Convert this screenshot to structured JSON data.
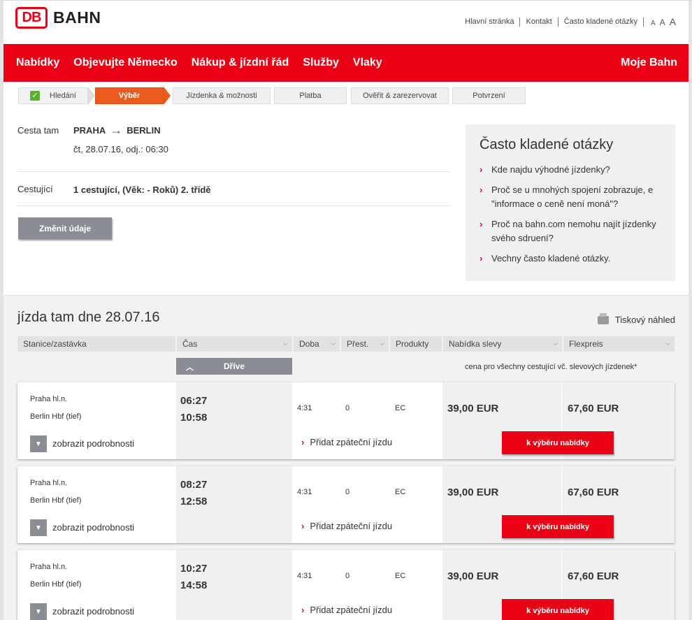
{
  "brand": {
    "logo": "DB",
    "name": "BAHN"
  },
  "topnav": [
    "Hlavní stránka",
    "Kontakt",
    "Často kladené otázky"
  ],
  "font_size_controls": [
    "A",
    "A",
    "A"
  ],
  "mainnav": [
    "Nabídky",
    "Objevujte Německo",
    "Nákup & jízdní řád",
    "Služby",
    "Vlaky"
  ],
  "mainnav_right": "Moje Bahn",
  "steps": [
    "Hledání",
    "Výběr",
    "Jízdenka & možnosti",
    "Platba",
    "Ověřit & zarezervovat",
    "Potvrzení"
  ],
  "summary": {
    "outbound_label": "Cesta tam",
    "from": "PRAHA",
    "to": "BERLIN",
    "datetime": "čt, 28.07.16, odj.: 06:30",
    "passengers_label": "Cestující",
    "passengers": "1 cestující, (Věk: - Roků) 2. třídě",
    "change_button": "Změnit údaje"
  },
  "faq": {
    "title": "Často kladené otázky",
    "items": [
      "Kde najdu výhodné jízdenky?",
      "Proč se u mnohých spojení zobrazuje, e \"informace o ceně není moná\"?",
      "Proč na bahn.com nemohu najít jízdenky svého sdruení?",
      "Vechny často kladené otázky."
    ]
  },
  "results": {
    "title": "jízda tam dne 28.07.16",
    "print_label": "Tiskový náhled",
    "columns": [
      "Stanice/zastávka",
      "Čas",
      "Doba",
      "Přest.",
      "Produkty",
      "Nabídka slevy",
      "Flexpreis"
    ],
    "earlier_button": "Dříve",
    "price_note": "cena pro všechny cestující vč. slevových jízdenek*",
    "detail_label": "zobrazit podrobnosti",
    "return_label": "Přidat zpáteční jízdu",
    "select_label": "k výběru nabídky",
    "connections": [
      {
        "from": "Praha hl.n.",
        "to": "Berlin Hbf (tief)",
        "dep": "06:27",
        "arr": "10:58",
        "duration": "4:31",
        "changes": "0",
        "product": "EC",
        "saver": "39,00 EUR",
        "flex": "67,60 EUR"
      },
      {
        "from": "Praha hl.n.",
        "to": "Berlin Hbf (tief)",
        "dep": "08:27",
        "arr": "12:58",
        "duration": "4:31",
        "changes": "0",
        "product": "EC",
        "saver": "39,00 EUR",
        "flex": "67,60 EUR"
      },
      {
        "from": "Praha hl.n.",
        "to": "Berlin Hbf (tief)",
        "dep": "10:27",
        "arr": "14:58",
        "duration": "4:31",
        "changes": "0",
        "product": "EC",
        "saver": "39,00 EUR",
        "flex": "67,60 EUR"
      }
    ]
  },
  "colors": {
    "brand_red": "#ec0016",
    "active_step": "#ec5b1e",
    "button_grey": "#8a8d94"
  }
}
